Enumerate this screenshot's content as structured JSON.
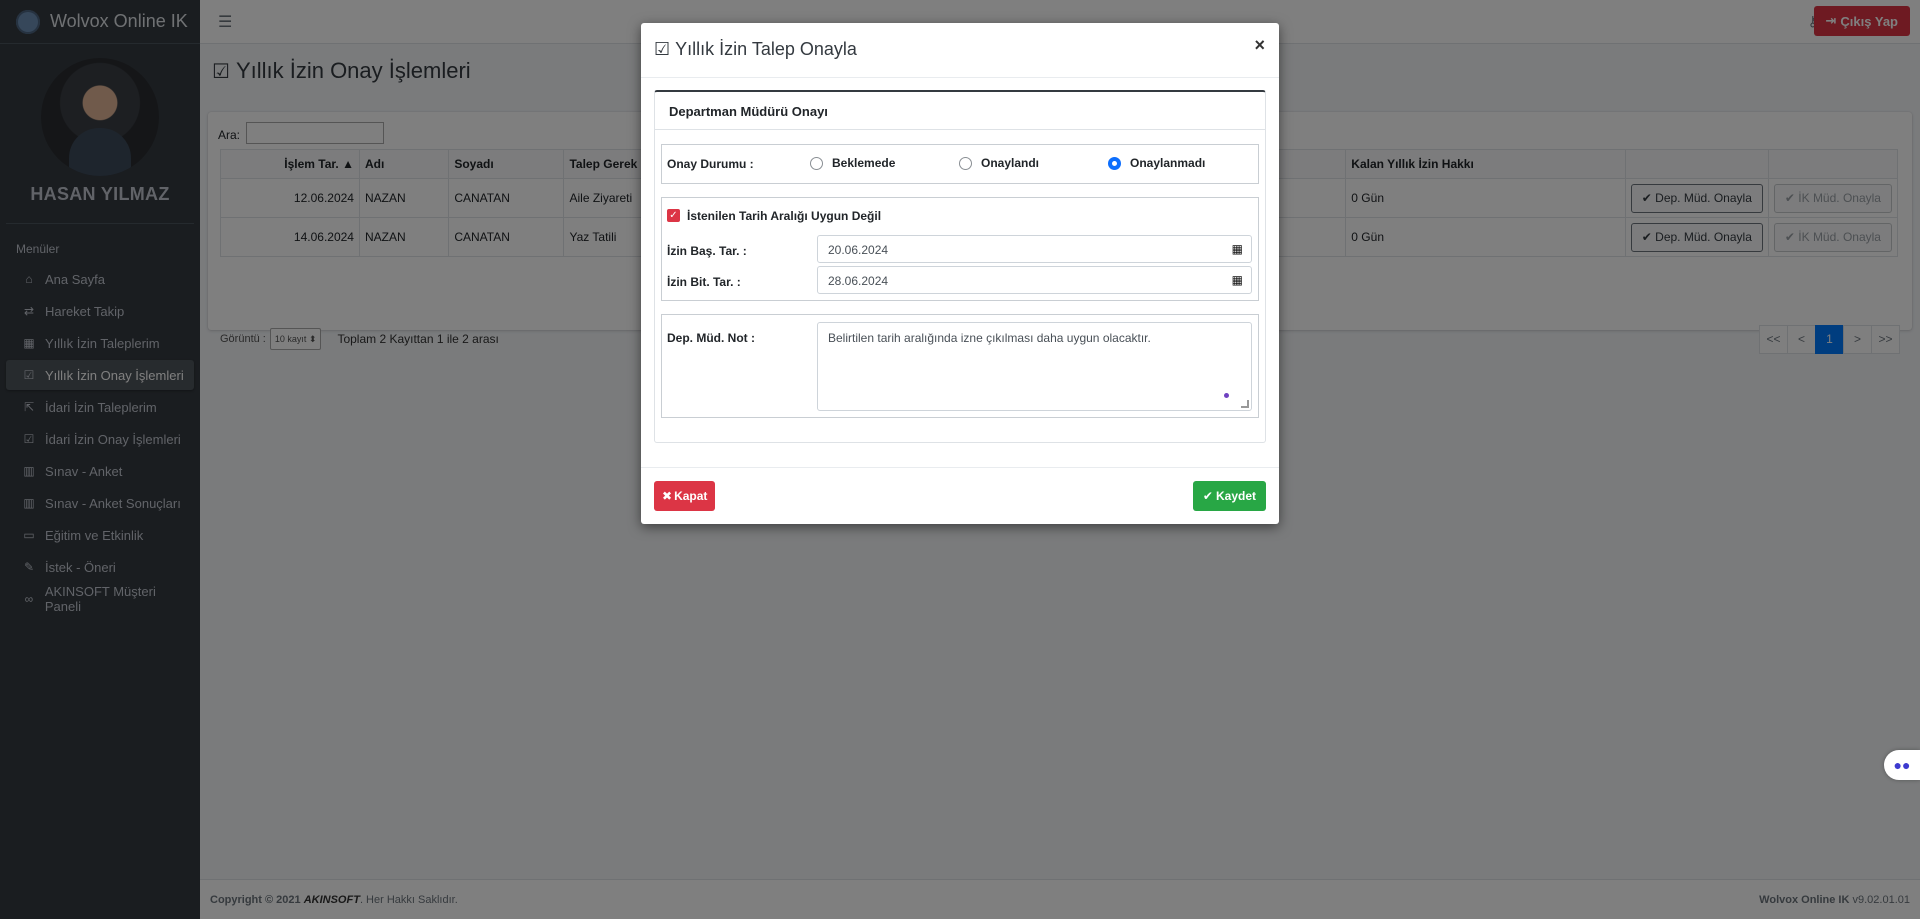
{
  "app": {
    "brand": "Wolvox Online IK",
    "user_name": "HASAN YILMAZ"
  },
  "topbar": {
    "logout_label": "Çıkış Yap"
  },
  "sidebar": {
    "menu_header": "Menüler",
    "items": [
      {
        "label": "Ana Sayfa",
        "icon": "home-icon"
      },
      {
        "label": "Hareket Takip",
        "icon": "exchange-icon"
      },
      {
        "label": "Yıllık İzin Taleplerim",
        "icon": "calendar-icon"
      },
      {
        "label": "Yıllık İzin Onay İşlemleri",
        "icon": "calendar-check-icon"
      },
      {
        "label": "İdari İzin Taleplerim",
        "icon": "share-square-icon"
      },
      {
        "label": "İdari İzin Onay İşlemleri",
        "icon": "calendar-check-icon"
      },
      {
        "label": "Sınav - Anket",
        "icon": "table-icon"
      },
      {
        "label": "Sınav - Anket Sonuçları",
        "icon": "table-icon"
      },
      {
        "label": "Eğitim ve Etkinlik",
        "icon": "chalkboard-icon"
      },
      {
        "label": "İstek - Öneri",
        "icon": "edit-icon"
      },
      {
        "label": "AKINSOFT Müşteri Paneli",
        "icon": "link-icon"
      }
    ]
  },
  "page": {
    "title": "Yıllık İzin Onay İşlemleri",
    "search_label": "Ara:",
    "columns": [
      "İşlem Tar.",
      "Adı",
      "Soyadı",
      "Talep Gerek",
      "Kalan Yıllık İzin Hakkı",
      "",
      ""
    ],
    "rows": [
      {
        "date": "12.06.2024",
        "name": "NAZAN",
        "surname": "CANATAN",
        "reason": "Aile Ziyareti",
        "remaining": "0 Gün",
        "dep_btn": "Dep. Müd. Onayla",
        "ik_btn": "İK Müd. Onayla"
      },
      {
        "date": "14.06.2024",
        "name": "NAZAN",
        "surname": "CANATAN",
        "reason": "Yaz Tatili",
        "remaining": "0 Gün",
        "dep_btn": "Dep. Müd. Onayla",
        "ik_btn": "İK Müd. Onayla"
      }
    ],
    "show_label": "Görüntü :",
    "page_size": "10 kayıt",
    "records_info": "Toplam 2 Kayıttan 1 ile 2 arası",
    "pager": [
      "<<",
      "<",
      "1",
      ">",
      ">>"
    ]
  },
  "modal": {
    "title": "Yıllık İzin Talep Onayla",
    "close": "×",
    "section_title": "Departman Müdürü Onayı",
    "status_label": "Onay Durumu :",
    "options": [
      "Beklemede",
      "Onaylandı",
      "Onaylanmadı"
    ],
    "selected_option": "Onaylanmadı",
    "checkbox_label": "İstenilen Tarih Aralığı Uygun Değil",
    "start_label": "İzin Baş. Tar. :",
    "start_value": "20.06.2024",
    "end_label": "İzin Bit. Tar. :",
    "end_value": "28.06.2024",
    "note_label": "Dep. Müd. Not :",
    "note_value": "Belirtilen tarih aralığında izne çıkılması daha uygun olacaktır.",
    "close_button": "Kapat",
    "save_button": "Kaydet"
  },
  "footer": {
    "copyright_prefix": "Copyright © 2021",
    "copyright_brand": "AKINSOFT",
    "copyright_suffix": ". Her Hakkı Saklıdır.",
    "app_name": "Wolvox Online IK",
    "version": "v9.02.01.01"
  }
}
